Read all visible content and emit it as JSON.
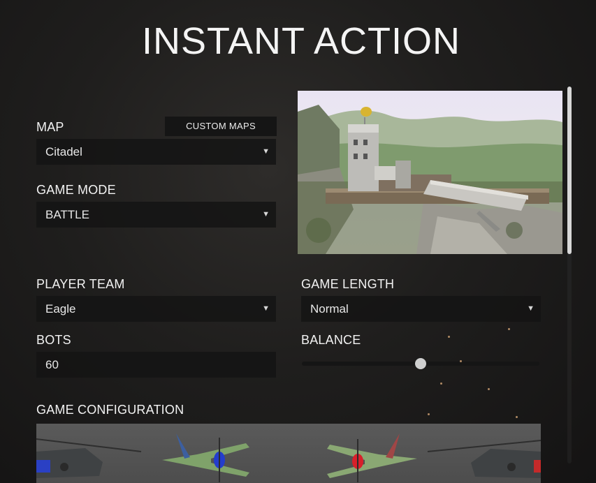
{
  "header": {
    "title": "INSTANT ACTION"
  },
  "map": {
    "label": "MAP",
    "value": "Citadel",
    "custom_maps_label": "CUSTOM MAPS"
  },
  "game_mode": {
    "label": "GAME MODE",
    "value": "BATTLE"
  },
  "player_team": {
    "label": "PLAYER TEAM",
    "value": "Eagle"
  },
  "game_length": {
    "label": "GAME LENGTH",
    "value": "Normal"
  },
  "bots": {
    "label": "BOTS",
    "value": "60"
  },
  "balance": {
    "label": "BALANCE",
    "level": 0.5
  },
  "game_configuration": {
    "label": "GAME CONFIGURATION"
  },
  "icons": {
    "dropdown": "chevron-down-icon"
  },
  "colors": {
    "team_blue": "#2a4ad8",
    "team_red": "#d8202a",
    "aircraft_green": "#7fa26a"
  }
}
